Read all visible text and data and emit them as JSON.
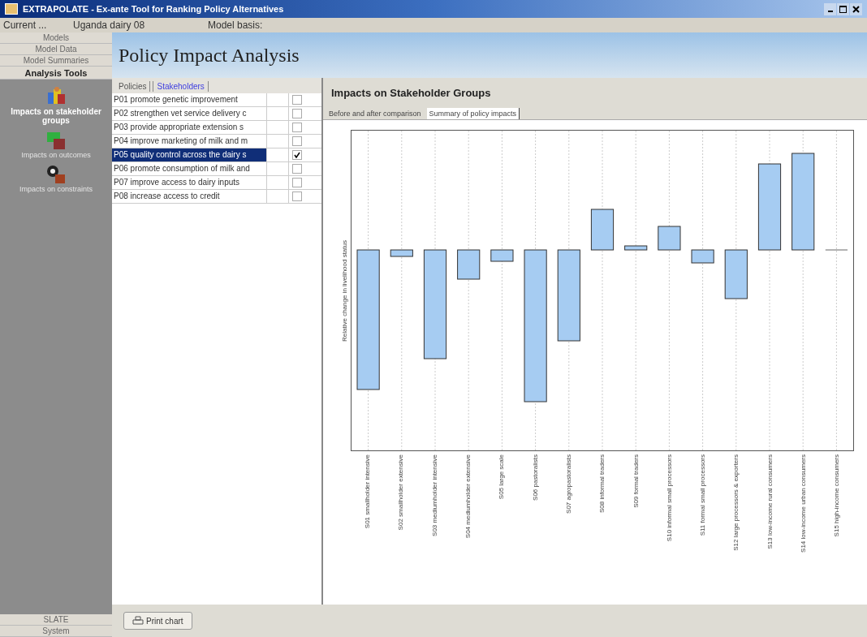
{
  "window": {
    "title": "EXTRAPOLATE - Ex-ante Tool for Ranking Policy Alternatives"
  },
  "info_bar": {
    "current_label": "Current ...",
    "current_value": "Uganda dairy 08",
    "basis_label": "Model basis:"
  },
  "sidebar": {
    "sections": [
      {
        "label": "Models",
        "selected": false
      },
      {
        "label": "Model Data",
        "selected": false
      },
      {
        "label": "Model Summaries",
        "selected": false
      },
      {
        "label": "Analysis Tools",
        "selected": true
      }
    ],
    "tools": [
      {
        "label": "Impacts on stakeholder groups",
        "kind": "people",
        "selected": true
      },
      {
        "label": "Impacts on outcomes",
        "kind": "outcomes",
        "selected": false
      },
      {
        "label": "Impacts on constraints",
        "kind": "gears",
        "selected": false
      }
    ],
    "bottom_sections": [
      "SLATE",
      "System"
    ]
  },
  "page_title": "Policy Impact Analysis",
  "list_tabs": [
    {
      "label": "Policies",
      "selected": false
    },
    {
      "label": "Stakeholders",
      "selected": true
    }
  ],
  "policies": [
    {
      "label": "P01 promote genetic improvement",
      "selected": false,
      "checked": false
    },
    {
      "label": "P02 strengthen vet service delivery c",
      "selected": false,
      "checked": false
    },
    {
      "label": "P03 provide appropriate extension s",
      "selected": false,
      "checked": false
    },
    {
      "label": "P04 improve marketing of milk and m",
      "selected": false,
      "checked": false
    },
    {
      "label": "P05 quality control across the dairy s",
      "selected": true,
      "checked": true
    },
    {
      "label": "P06 promote consumption of milk and",
      "selected": false,
      "checked": false
    },
    {
      "label": "P07 improve access to dairy inputs",
      "selected": false,
      "checked": false
    },
    {
      "label": "P08 increase access to credit",
      "selected": false,
      "checked": false
    }
  ],
  "chart_panel": {
    "title": "Impacts on Stakeholder Groups",
    "tabs": [
      {
        "label": "Before and after comparison",
        "selected": false
      },
      {
        "label": "Summary of policy impacts",
        "selected": true
      }
    ],
    "ylabel": "Relative change in livelihood status",
    "categories": [
      "S01 smallholder intensive",
      "S02 smallholder extensive",
      "S03 mediumholder intensive",
      "S04 mediumholder extensive",
      "S05 large scale",
      "S06 pastoralists",
      "S07 agropastoralists",
      "S08 informal traders",
      "S09 formal traders",
      "S10 informal small processors",
      "S11 formal small processors",
      "S12 large processors & exporters",
      "S13 low-income rural consumers",
      "S14 low-income urban consumers",
      "S15 high-income consumers"
    ]
  },
  "print_button": "Print chart"
}
